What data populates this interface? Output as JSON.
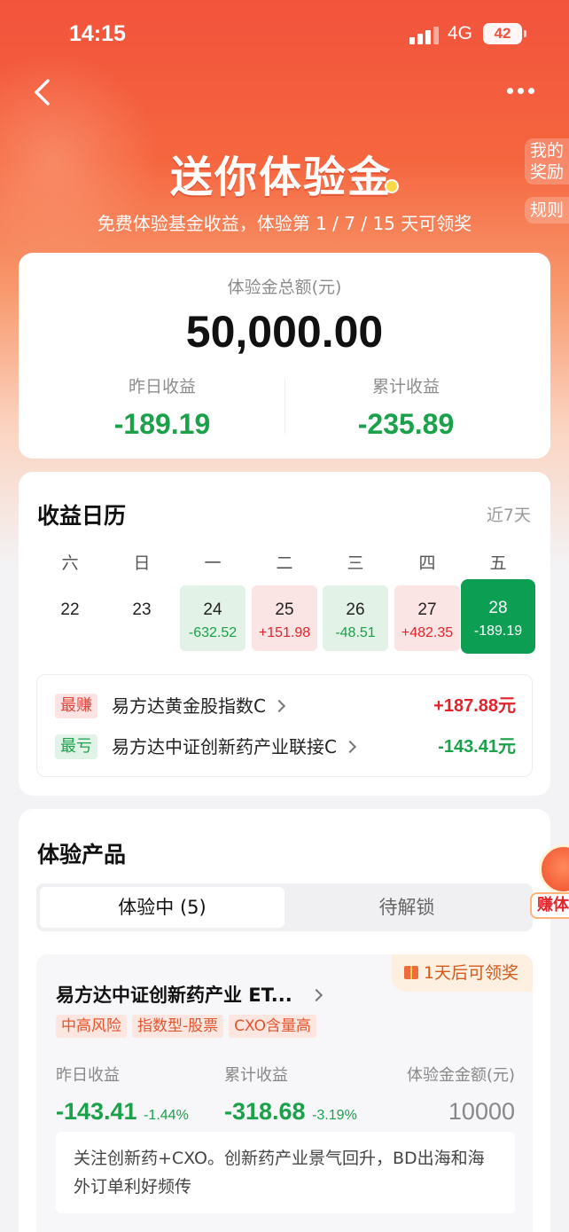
{
  "status_bar": {
    "time": "14:15",
    "network": "4G",
    "battery": "42"
  },
  "header": {
    "title": "送你体验金",
    "subtitle": "免费体验基金收益，体验第 1 / 7 / 15 天可领奖",
    "side_tabs": [
      "我的奖励",
      "规则"
    ],
    "side_tab_lines": [
      [
        "我的",
        "奖励"
      ],
      [
        "规则"
      ]
    ]
  },
  "summary": {
    "total_label": "体验金总额(元)",
    "total_value": "50,000.00",
    "yesterday_label": "昨日收益",
    "yesterday_value": "-189.19",
    "cumulative_label": "累计收益",
    "cumulative_value": "-235.89"
  },
  "calendar": {
    "title": "收益日历",
    "range": "近7天",
    "weekdays": [
      "六",
      "日",
      "一",
      "二",
      "三",
      "四",
      "五"
    ],
    "days": [
      {
        "date": "22",
        "gain": "",
        "state": "none"
      },
      {
        "date": "23",
        "gain": "",
        "state": "none"
      },
      {
        "date": "24",
        "gain": "-632.52",
        "state": "neg"
      },
      {
        "date": "25",
        "gain": "+151.98",
        "state": "pos"
      },
      {
        "date": "26",
        "gain": "-48.51",
        "state": "neg"
      },
      {
        "date": "27",
        "gain": "+482.35",
        "state": "pos"
      },
      {
        "date": "28",
        "gain": "-189.19",
        "state": "today"
      }
    ],
    "best": {
      "tag": "最赚",
      "fund": "易方达黄金股指数C",
      "amount": "+187.88元"
    },
    "worst": {
      "tag": "最亏",
      "fund": "易方达中证创新药产业联接C",
      "amount": "-143.41元"
    }
  },
  "products": {
    "title": "体验产品",
    "tabs": [
      {
        "label": "体验中 (5)",
        "active": true
      },
      {
        "label": "待解锁",
        "active": false
      }
    ],
    "items": [
      {
        "badge": "1天后可领奖",
        "name": "易方达中证创新药产业 ET...",
        "tags": [
          "中高风险",
          "指数型-股票",
          "CXO含量高"
        ],
        "yesterday_label": "昨日收益",
        "yesterday_value": "-143.41",
        "yesterday_pct": "-1.44%",
        "cumulative_label": "累计收益",
        "cumulative_value": "-318.68",
        "cumulative_pct": "-3.19%",
        "amount_label": "体验金金额(元)",
        "amount_value": "10000",
        "note": "关注创新药+CXO。创新药产业景气回升，BD出海和海外订单利好频传"
      }
    ]
  },
  "floating": {
    "label": "赚体"
  },
  "colors": {
    "accent": "#f2533c",
    "gain_red": "#e3232a",
    "loss_green": "#1aa14a",
    "today_green": "#0c9e53"
  }
}
